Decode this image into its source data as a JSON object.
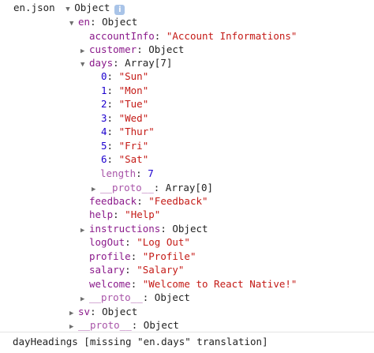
{
  "root": {
    "file_label": "en.json",
    "type": "Object"
  },
  "en": {
    "key": "en",
    "type": "Object"
  },
  "accountInfo": {
    "key": "accountInfo",
    "value": "\"Account Informations\""
  },
  "customer": {
    "key": "customer",
    "type": "Object"
  },
  "days": {
    "key": "days",
    "type": "Array[7]",
    "items": [
      {
        "index": "0",
        "value": "\"Sun\""
      },
      {
        "index": "1",
        "value": "\"Mon\""
      },
      {
        "index": "2",
        "value": "\"Tue\""
      },
      {
        "index": "3",
        "value": "\"Wed\""
      },
      {
        "index": "4",
        "value": "\"Thur\""
      },
      {
        "index": "5",
        "value": "\"Fri\""
      },
      {
        "index": "6",
        "value": "\"Sat\""
      }
    ],
    "length_key": "length",
    "length_value": "7",
    "proto_key": "__proto__",
    "proto_type": "Array[0]"
  },
  "feedback": {
    "key": "feedback",
    "value": "\"Feedback\""
  },
  "help": {
    "key": "help",
    "value": "\"Help\""
  },
  "instructions": {
    "key": "instructions",
    "type": "Object"
  },
  "logOut": {
    "key": "logOut",
    "value": "\"Log Out\""
  },
  "profile": {
    "key": "profile",
    "value": "\"Profile\""
  },
  "salary": {
    "key": "salary",
    "value": "\"Salary\""
  },
  "welcome": {
    "key": "welcome",
    "value": "\"Welcome to React Native!\""
  },
  "en_proto": {
    "key": "__proto__",
    "type": "Object"
  },
  "sv": {
    "key": "sv",
    "type": "Object"
  },
  "root_proto": {
    "key": "__proto__",
    "type": "Object"
  },
  "warning": {
    "text": "dayHeadings [missing \"en.days\" translation]"
  },
  "symbols": {
    "expanded": "▼",
    "collapsed": "▶",
    "colon": ":",
    "info": "i"
  }
}
